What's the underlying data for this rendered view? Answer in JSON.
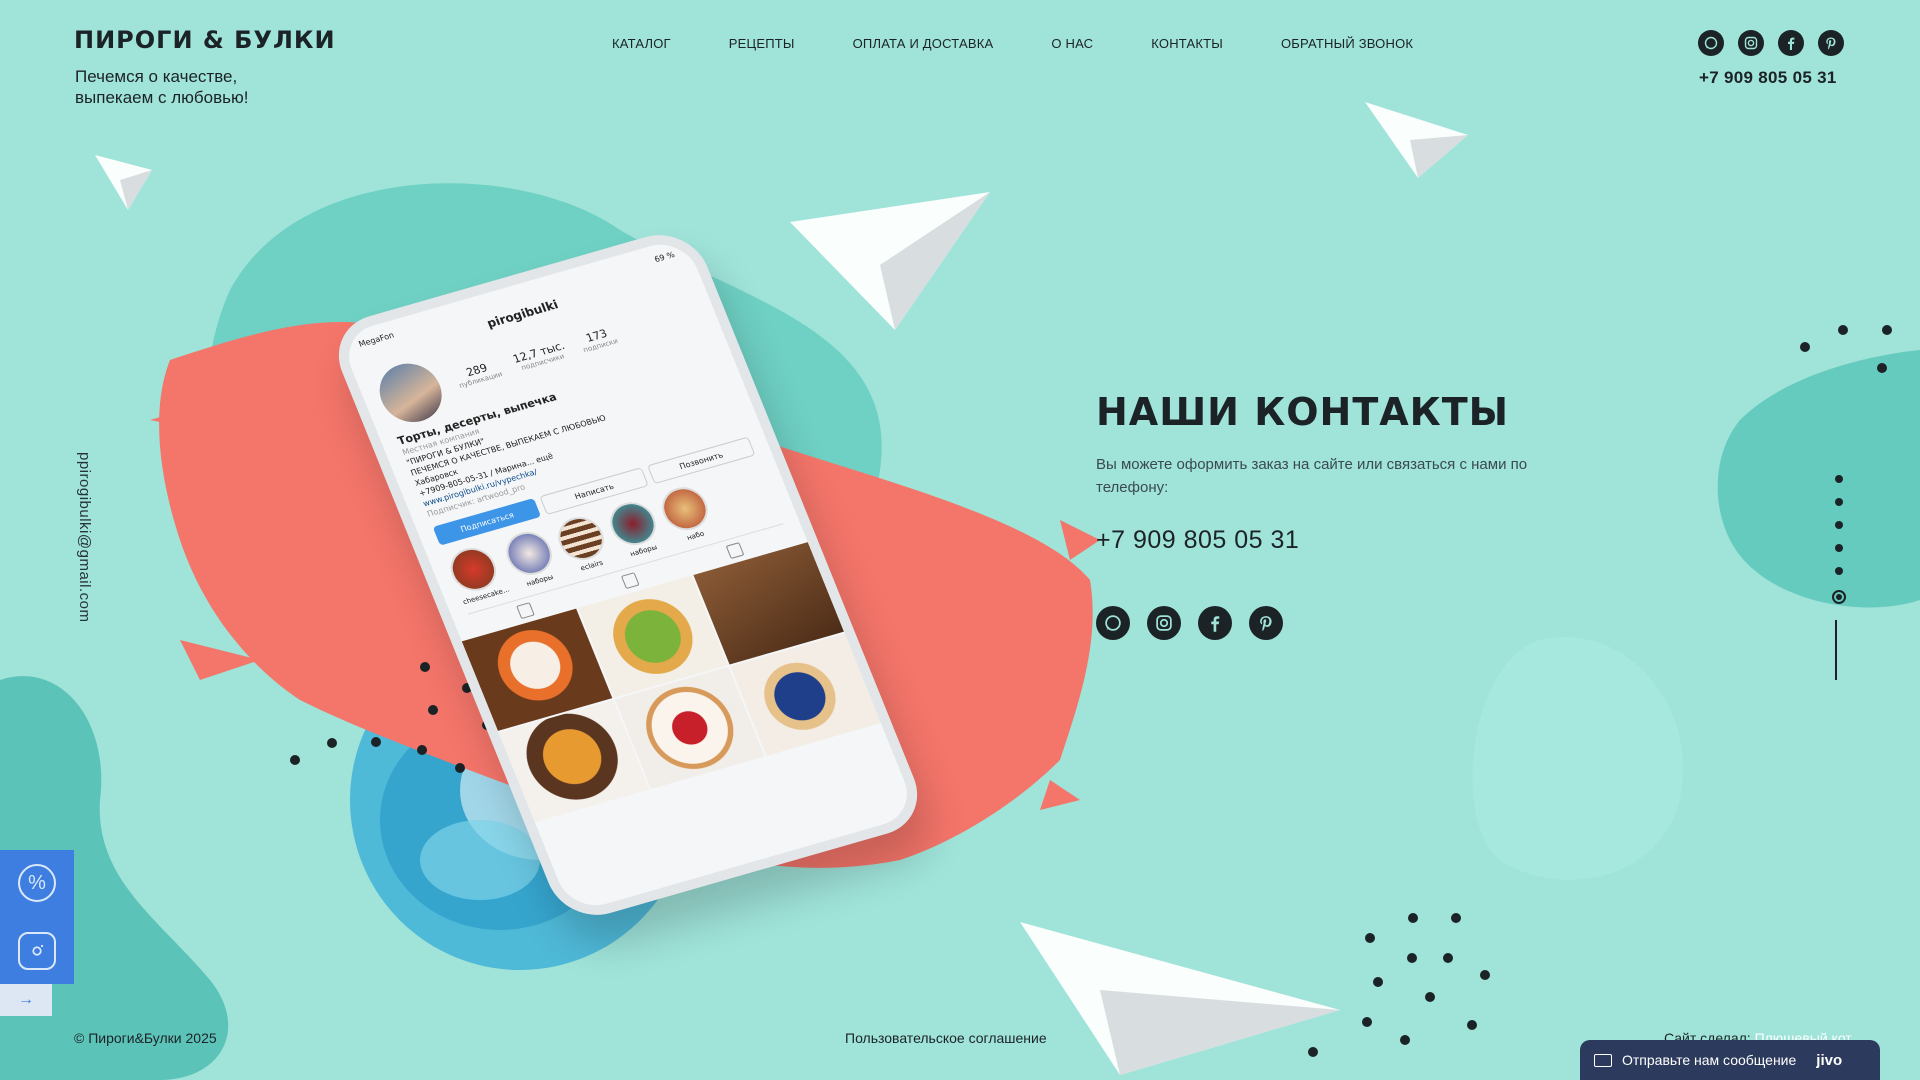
{
  "header": {
    "logo": "ПИРОГИ & БУЛКИ",
    "tagline": "Печемся о качестве,\nвыпекаем с любовью!",
    "nav": [
      "КАТАЛОГ",
      "РЕЦЕПТЫ",
      "ОПЛАТА И ДОСТАВКА",
      "О НАС",
      "КОНТАКТЫ",
      "ОБРАТНЫЙ ЗВОНОК"
    ],
    "phone": "+7 909 805 05 31",
    "social": [
      "whatsapp-icon",
      "instagram-icon",
      "facebook-icon",
      "pinterest-icon"
    ]
  },
  "side": {
    "email": "ppirogibulki@gmail.com"
  },
  "contacts": {
    "title": "НАШИ КОНТАКТЫ",
    "description": "Вы можете оформить заказ на сайте или связаться с нами по телефону:",
    "phone": "+7 909 805 05 31"
  },
  "phone_mockup": {
    "status_carrier": "MegaFon",
    "status_battery": "69 %",
    "username": "pirogibulki",
    "stats": [
      {
        "value": "289",
        "label": "публикации"
      },
      {
        "value": "12,7 тыс.",
        "label": "подписчики"
      },
      {
        "value": "173",
        "label": "подписки"
      }
    ],
    "bio_title": "Торты, десерты, выпечка",
    "bio_type": "Местная компания",
    "bio_line1": "\"ПИРОГИ & БУЛКИ\"",
    "bio_line2": "ПЕЧЕМСЯ О КАЧЕСТВЕ, ВЫПЕКАЕМ С ЛЮБОВЬЮ",
    "bio_city": "Хабаровск",
    "bio_phone": "+7909-805-05-31 / Марина... ещё",
    "bio_link": "www.pirogibulki.ru/vypechka/",
    "bio_followed": "Подписчик: artwood_pro",
    "buttons": [
      "Подписаться",
      "Написать",
      "Позвонить"
    ],
    "highlights": [
      "cheesecake...",
      "наборы",
      "eclairs",
      "наборы",
      "набо"
    ]
  },
  "footer": {
    "copyright": "© Пироги&Булки 2025",
    "agreement": "Пользовательское соглашение",
    "made_by_label": "Сайт сделал:",
    "made_by_link": "Плюшевый кот"
  },
  "chat": {
    "label": "Отправьте нам сообщение",
    "brand": "jivo"
  },
  "colors": {
    "background": "#9fe3d9",
    "accent_coral": "#f4756a",
    "side_panel": "#3d7ee0",
    "chat_bg": "#2c3a5d",
    "text_dark": "#1c2326"
  }
}
